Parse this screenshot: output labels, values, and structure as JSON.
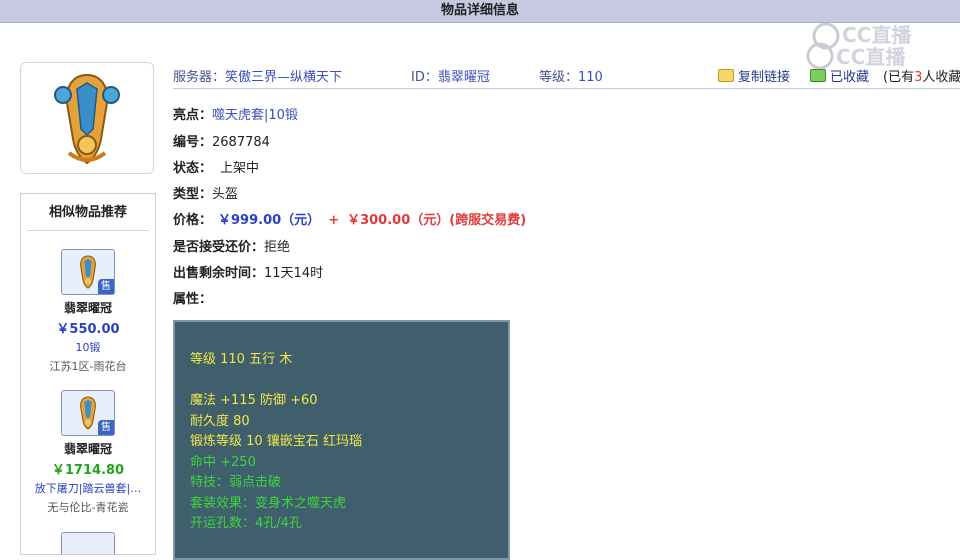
{
  "header": {
    "title": "物品详细信息"
  },
  "watermark": {
    "text1": "CC直播",
    "text2": "CC直播"
  },
  "server_bar": {
    "server_label": "服务器：",
    "server_value": "笑傲三界—纵横天下",
    "id_label": "ID：",
    "id_value": "翡翠曜冠",
    "level_label": "等级：",
    "level_value": "110",
    "copy_link": "复制链接",
    "favorited": "已收藏",
    "fav_count_prefix": "(已有",
    "fav_count": "3",
    "fav_count_suffix": "人收藏"
  },
  "details": {
    "highlight_label": "亮点：",
    "highlight_value": "噬天虎套|10锻",
    "number_label": "编号：",
    "number_value": "2687784",
    "status_label": "状态：",
    "status_value": "上架中",
    "type_label": "类型：",
    "type_value": "头盔",
    "price_label": "价格：",
    "price_value": "￥999.00（元）",
    "price_plus": "+",
    "fee_value": "￥300.00（元）(跨服交易费)",
    "counter_label": "是否接受还价：",
    "counter_value": "拒绝",
    "remaining_label": "出售剩余时间：",
    "remaining_value": "11天14时",
    "attr_label": "属性："
  },
  "attributes": [
    {
      "text": "等级 110 五行 木",
      "color": "#f2e64a"
    },
    {
      "text": "",
      "color": "#f2e64a"
    },
    {
      "text": "魔法 +115 防御 +60",
      "color": "#f2e64a"
    },
    {
      "text": "耐久度 80",
      "color": "#f2e64a"
    },
    {
      "text": "锻炼等级 10 镶嵌宝石 红玛瑙",
      "color": "#f2e64a"
    },
    {
      "text": "命中 +250",
      "color": "#3fd43f"
    },
    {
      "text": "特技：弱点击破",
      "color": "#3fd43f"
    },
    {
      "text": "套装效果：变身术之噬天虎",
      "color": "#3fd43f"
    },
    {
      "text": "开运孔数：4孔/4孔",
      "color": "#3fd43f"
    }
  ],
  "related": {
    "title": "相似物品推荐",
    "badge": "售",
    "items": [
      {
        "name": "翡翠曜冠",
        "price": "￥550.00",
        "sub": "10锻",
        "server": "江苏1区-雨花台"
      },
      {
        "name": "翡翠曜冠",
        "price": "￥1714.80",
        "sub": "放下屠刀|踏云兽套|…",
        "server": "无与伦比-青花瓷"
      }
    ]
  }
}
